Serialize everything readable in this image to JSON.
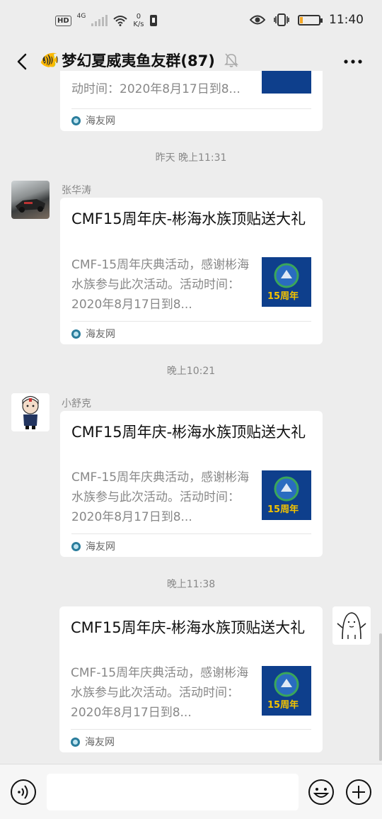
{
  "status": {
    "hd": "HD",
    "network": "4G",
    "speed_value": "0",
    "speed_unit": "K/s",
    "time": "11:40",
    "battery_level": 0.15
  },
  "header": {
    "title": "梦幻夏威夷鱼友群(87)",
    "fish_emoji": "🐠"
  },
  "messages": [
    {
      "partial": true,
      "desc": "动时间：2020年8月17日到8...",
      "source": "海友网"
    },
    {
      "timestamp": "昨天 晚上11:31",
      "sender": "张华涛",
      "title": "CMF15周年庆-彬海水族顶贴送大礼",
      "desc": "CMF-15周年庆典活动，感谢彬海水族参与此次活动。活动时间：2020年8月17日到8...",
      "source": "海友网",
      "thumb_text": "15周年"
    },
    {
      "timestamp": "晚上10:21",
      "sender": "小舒克",
      "title": "CMF15周年庆-彬海水族顶贴送大礼",
      "desc": "CMF-15周年庆典活动，感谢彬海水族参与此次活动。活动时间：2020年8月17日到8...",
      "source": "海友网",
      "thumb_text": "15周年"
    },
    {
      "timestamp": "晚上11:38",
      "title": "CMF15周年庆-彬海水族顶贴送大礼",
      "desc": "CMF-15周年庆典活动，感谢彬海水族参与此次活动。活动时间：2020年8月17日到8...",
      "source": "海友网",
      "thumb_text": "15周年"
    }
  ],
  "input": {
    "placeholder": ""
  },
  "colors": {
    "background": "#ededed",
    "card": "#ffffff",
    "muted": "#888888",
    "thumb": "#0e3f8c",
    "thumb_text": "#f2c200"
  }
}
